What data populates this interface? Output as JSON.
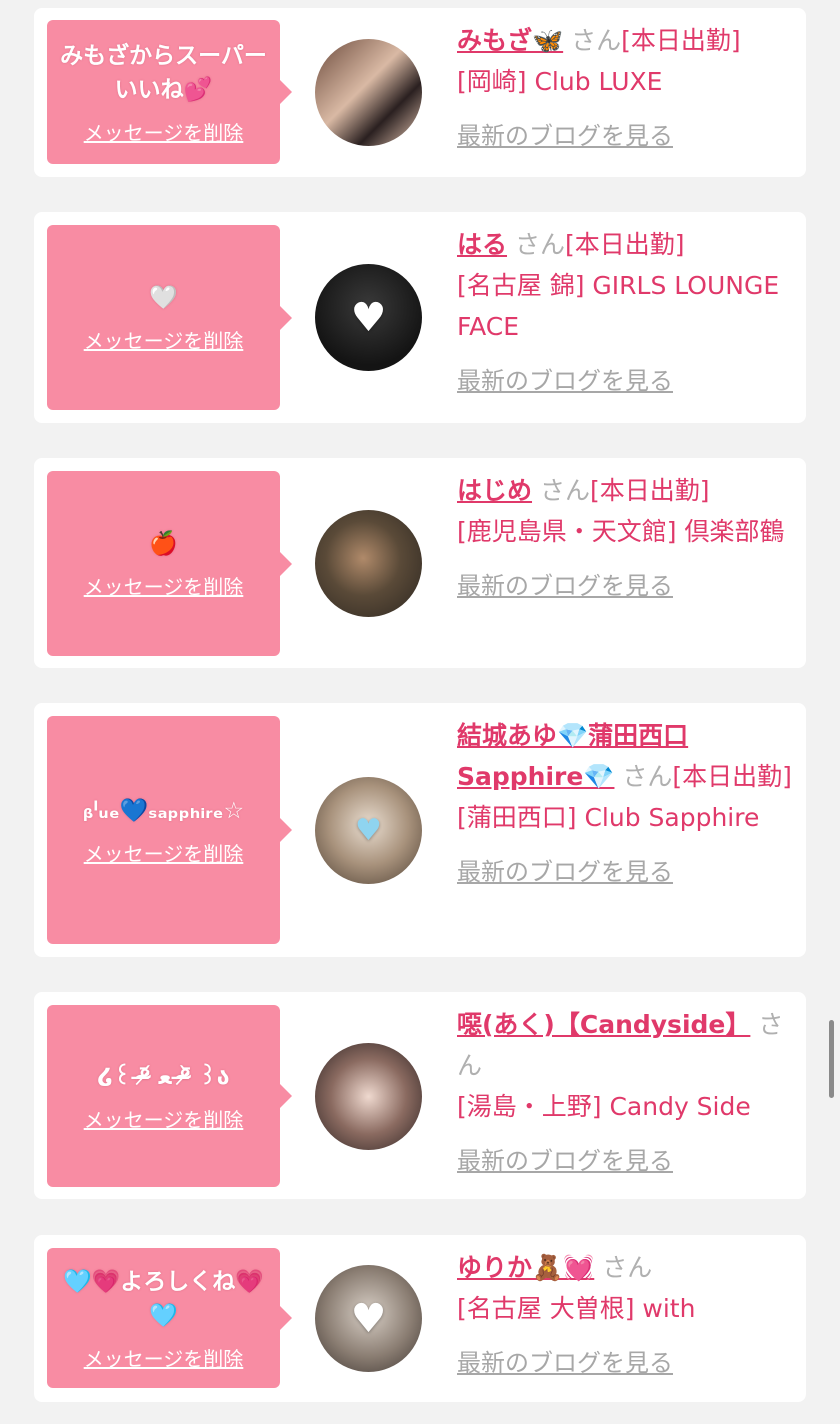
{
  "delete_label": "メッセージを削除",
  "blog_label": "最新のブログを見る",
  "accent_color": "#e0396a",
  "bubble_color": "#f88ca3",
  "items": [
    {
      "message": "みもざからスーパーいいね💕",
      "name": "みもざ🦋",
      "san": "さん",
      "status": "[本日出勤]",
      "shop": "[岡崎] Club LUXE",
      "avatar_icon": "photo"
    },
    {
      "message": "🤍",
      "name": "はる",
      "san": "さん",
      "status": "[本日出勤]",
      "shop": "[名古屋 錦] GIRLS LOUNGE FACE",
      "avatar_icon": "white-heart"
    },
    {
      "message": "🍎",
      "name": "はじめ",
      "san": "さん",
      "status": "[本日出勤]",
      "shop": "[鹿児島県・天文館] 倶楽部鶴",
      "avatar_icon": "photo"
    },
    {
      "message": "ᵦˡᵤₑ💙ₛₐₚₚₕᵢᵣₑ☆",
      "name": "結城あゆ💎蒲田西口Sapphire💎",
      "san": "さん",
      "status": "[本日出勤]",
      "shop": "[蒲田西口] Club Sapphire",
      "avatar_icon": "blue-heart"
    },
    {
      "message": "໒꒰ ᵒ̴̶̷᷄ ﻌ ᵒ̴̶̷᷅ ꒱ა",
      "name": "噁(あく)【Candyside】",
      "san": "さん",
      "status": "",
      "shop": "[湯島・上野] Candy Side",
      "avatar_icon": "photo"
    },
    {
      "message": "🩵💗よろしくね💗🩵",
      "name": "ゆりか🧸💓",
      "san": "さん",
      "status": "",
      "shop": "[名古屋 大曽根] with",
      "avatar_icon": "white-heart"
    }
  ]
}
